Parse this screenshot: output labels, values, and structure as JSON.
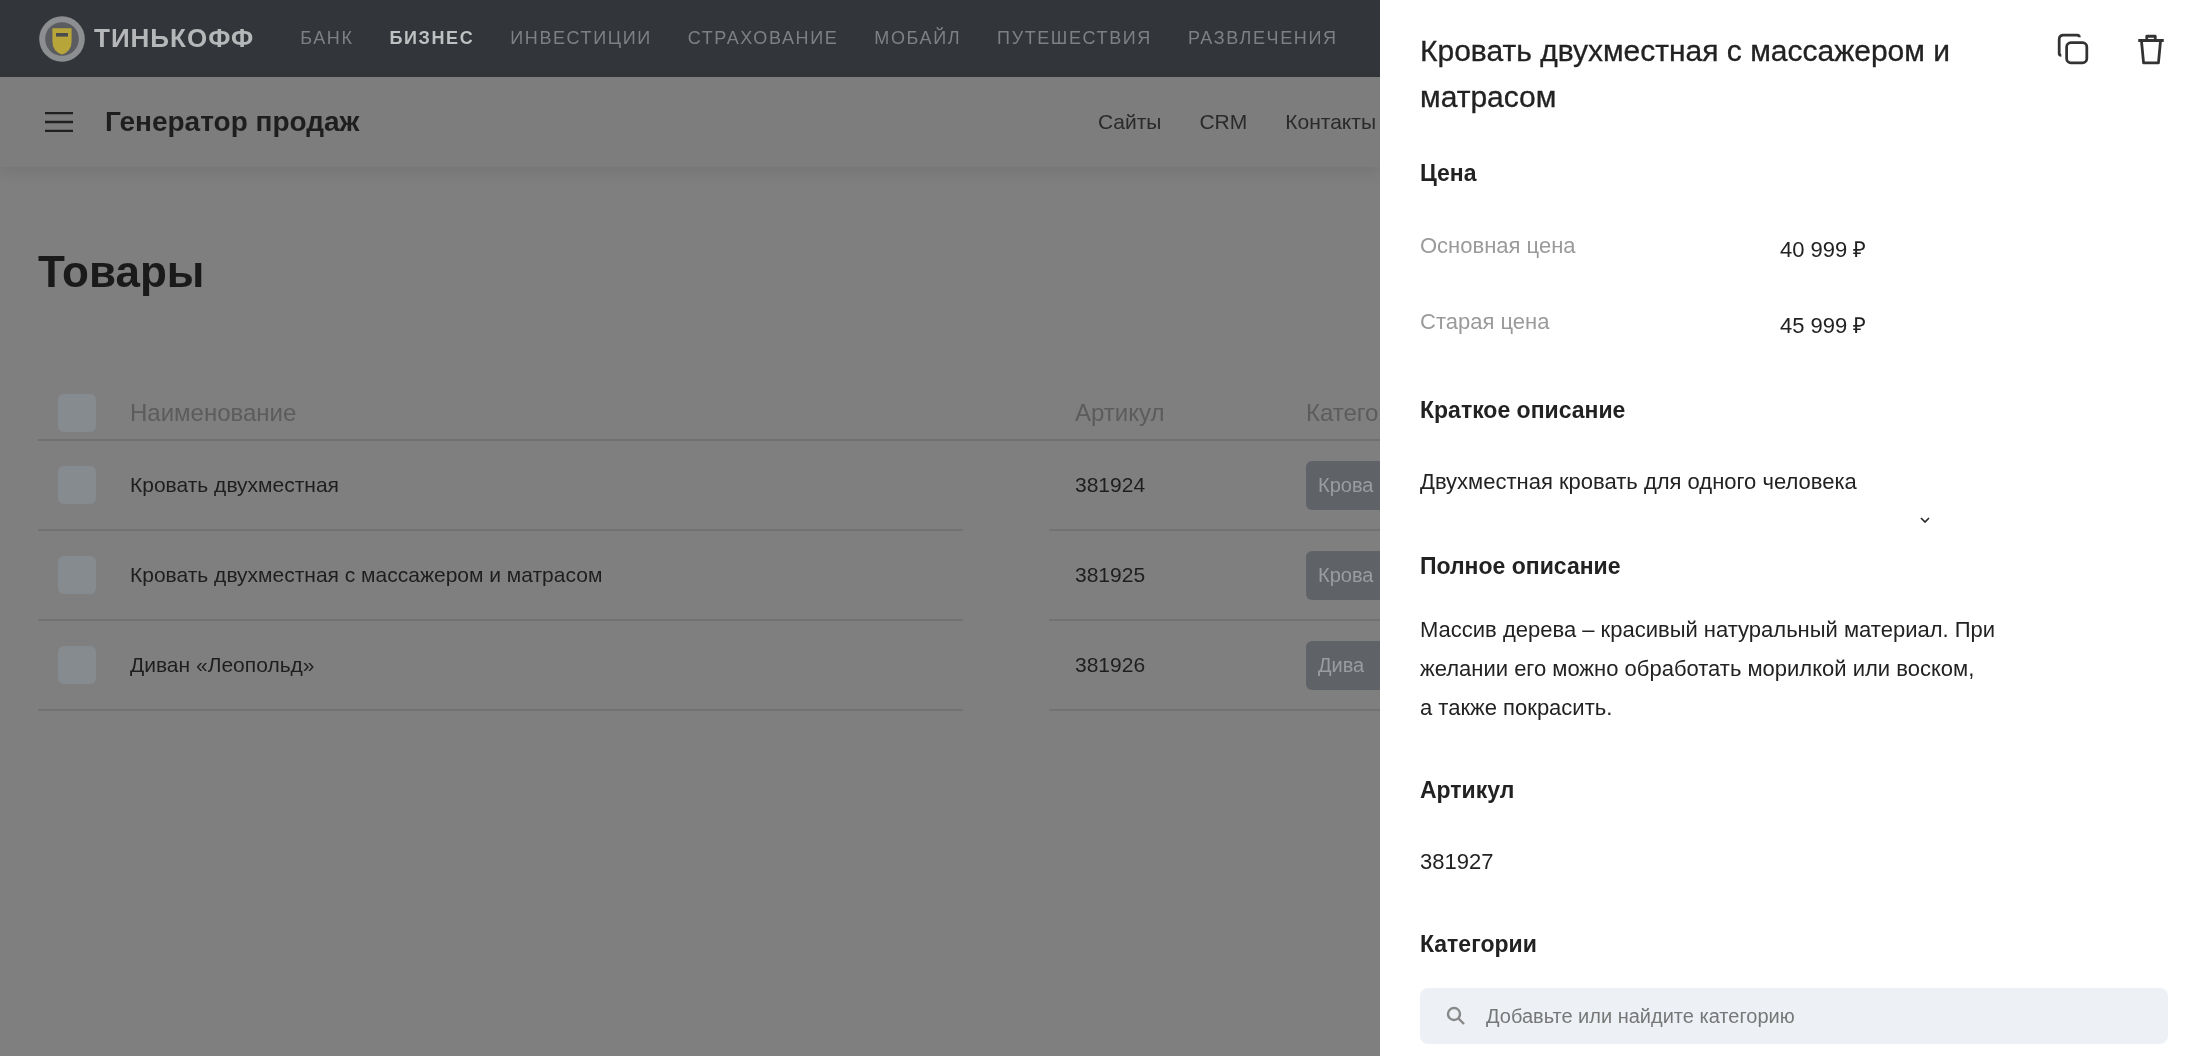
{
  "top_bar": {
    "logo": "ТИНЬКОФФ",
    "nav": [
      {
        "label": "БАНК",
        "selected": false
      },
      {
        "label": "БИЗНЕС",
        "selected": true
      },
      {
        "label": "ИНВЕСТИЦИИ",
        "selected": false
      },
      {
        "label": "СТРАХОВАНИЕ",
        "selected": false
      },
      {
        "label": "МОБАЙЛ",
        "selected": false
      },
      {
        "label": "ПУТЕШЕСТВИЯ",
        "selected": false
      },
      {
        "label": "РАЗВЛЕЧЕНИЯ",
        "selected": false
      }
    ]
  },
  "app_bar": {
    "title": "Генератор продаж",
    "links": [
      "Сайты",
      "CRM",
      "Контакты"
    ]
  },
  "page": {
    "title": "Товары",
    "table": {
      "columns": [
        "Наименование",
        "Артикул",
        "Катего"
      ],
      "header_checked": false,
      "rows": [
        {
          "checked": false,
          "name": "Кровать двухместная",
          "sku": "381924",
          "category": "Крова"
        },
        {
          "checked": false,
          "name": "Кровать двухместная с массажером и матрасом",
          "sku": "381925",
          "category": "Крова"
        },
        {
          "checked": false,
          "name": "Диван «Леопольд»",
          "sku": "381926",
          "category": "Дива"
        }
      ]
    }
  },
  "panel": {
    "title": "Кровать двухместная с массажером и матрасом",
    "price": {
      "heading": "Цена",
      "rows": [
        {
          "label": "Основная цена",
          "value": "40 999 ₽"
        },
        {
          "label": "Старая цена",
          "value": "45 999 ₽"
        }
      ]
    },
    "short": {
      "heading": "Краткое описание",
      "text": "Двухместная кровать для одного человека"
    },
    "full": {
      "heading": "Полное описание",
      "text": "Массив дерева – красивый натуральный материал. При\nжелании его можно обработать морилкой или воском,\nа также покрасить."
    },
    "sku": {
      "heading": "Артикул",
      "value": "381927"
    },
    "categories": {
      "heading": "Категории",
      "placeholder": "Добавьте или найдите категорию"
    }
  }
}
